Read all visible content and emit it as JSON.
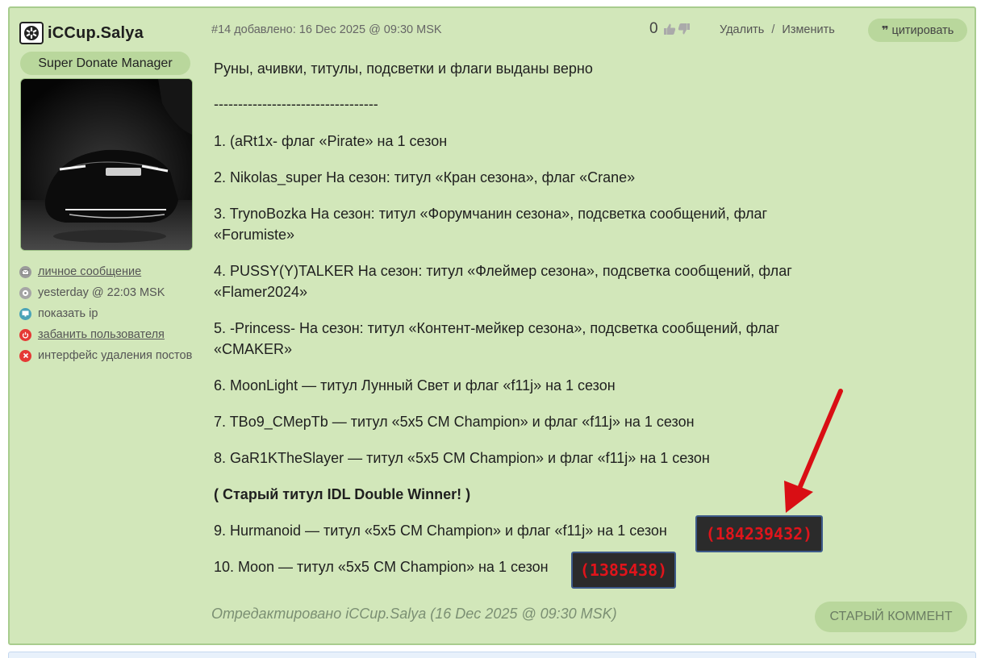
{
  "user": {
    "name": "iCCup.Salya",
    "role": "Super Donate Manager",
    "links": [
      {
        "icon": "message-icon",
        "label": "личное сообщение",
        "underline": true,
        "color": "#8a8a8a"
      },
      {
        "icon": "clock-icon",
        "label": "yesterday @ 22:03 MSK",
        "underline": false,
        "color": "#9a9a9a"
      },
      {
        "icon": "monitor-icon",
        "label": "показать ip",
        "underline": false,
        "color": "#4aa3b8"
      },
      {
        "icon": "power-icon",
        "label": "забанить пользователя",
        "underline": true,
        "color": "#e53935"
      },
      {
        "icon": "close-circle-icon",
        "label": "интерфейс удаления постов",
        "underline": false,
        "color": "#e53935"
      }
    ]
  },
  "post": {
    "meta": "#14 добавлено: 16 Dec 2025 @ 09:30 MSK",
    "rating": "0",
    "delete_label": "Удалить",
    "separator": "/",
    "edit_label": "Изменить",
    "quote_label": "цитировать",
    "lines": [
      "Руны, ачивки, титулы, подсветки и флаги выданы верно",
      "----------------------------------",
      "1. (aRt1x- флаг «Pirate» на 1 сезон",
      "2. Nikolas_super На сезон: титул «Кран сезона», флаг «Crane»",
      "3. TrynoBozka На сезон: титул «Форумчанин сезона», подсветка сообщений, флаг",
      "«Forumiste»",
      "4. PUSSY(Y)TALKER На сезон: титул «Флеймер сезона», подсветка сообщений, флаг",
      "«Flamer2024»",
      "5. -Princess- На сезон: титул «Контент-мейкер сезона», подсветка сообщений, флаг",
      "«CMAKER»",
      "6. MoonLight — титул Лунный Свет и флаг «f11j» на 1 сезон",
      "7. TBo9_CMepTb — титул «5x5 CM Champion» и флаг «f11j» на 1 сезон",
      "8. GaR1KTheSlayer — титул «5x5 CM Champion» и флаг «f11j» на 1 сезон",
      "( Старый титул IDL Double Winner! )",
      "9. Hurmanoid — титул «5x5 CM Champion» и флаг «f11j» на 1 сезон",
      "10. Moon — титул «5x5 CM Champion» на 1 сезон"
    ],
    "codes": [
      "(184239432)",
      "(1385438)"
    ],
    "edited": "Отредактировано iCCup.Salya (16 Dec 2025 @ 09:30 MSK)",
    "old_comment_label": "СТАРЫЙ КОММЕНТ"
  },
  "colors": {
    "post_bg": "#d2e7ba",
    "badge_bg": "#b9d79c",
    "code_text": "#e0141b",
    "arrow": "#d90e14"
  }
}
